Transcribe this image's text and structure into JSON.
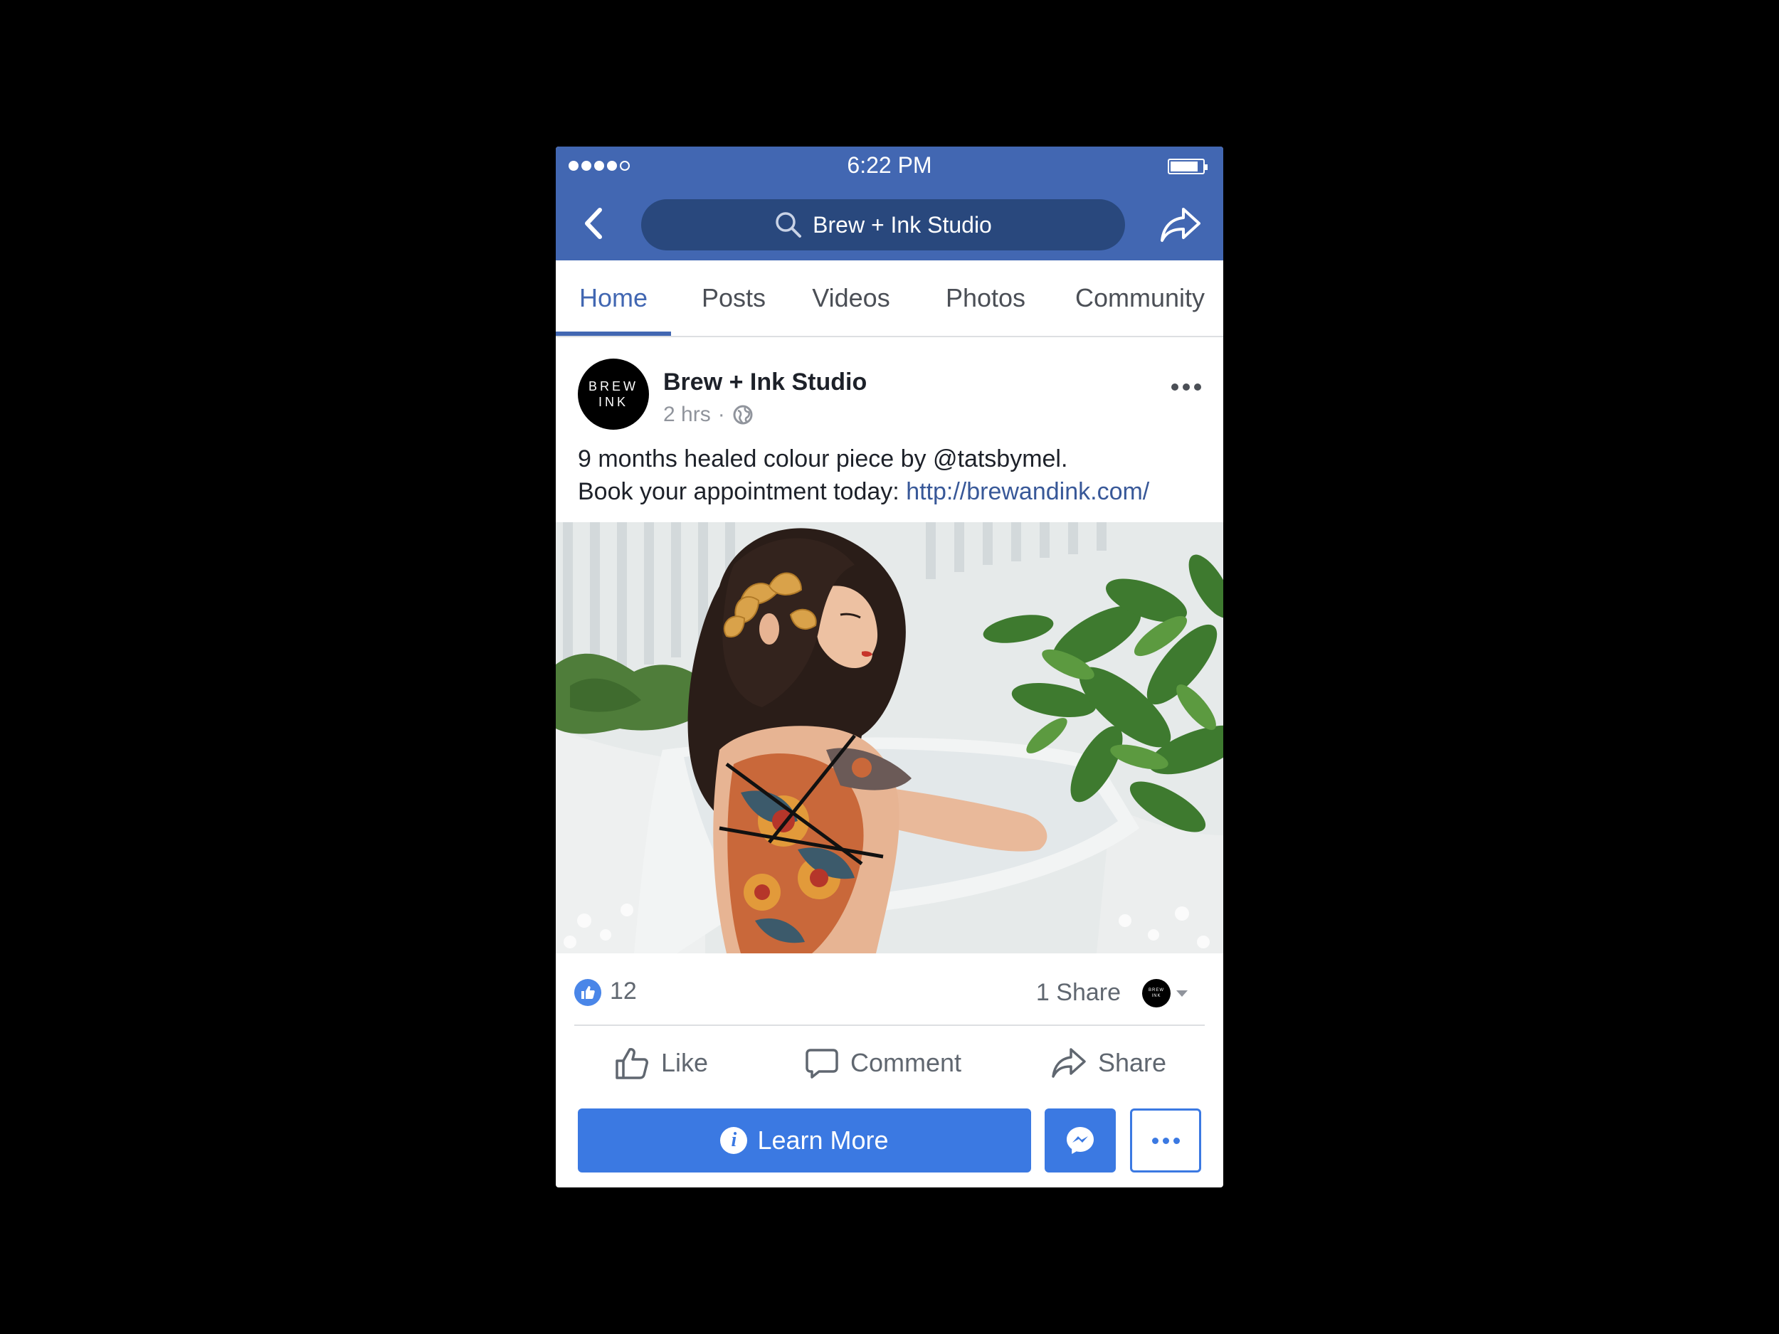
{
  "status_bar": {
    "time": "6:22 PM"
  },
  "nav": {
    "search_text": "Brew + Ink Studio"
  },
  "tabs": [
    {
      "label": "Home"
    },
    {
      "label": "Posts"
    },
    {
      "label": "Videos"
    },
    {
      "label": "Photos"
    },
    {
      "label": "Community"
    }
  ],
  "post": {
    "avatar_line1": "BREW",
    "avatar_line2": "INK",
    "author": "Brew + Ink Studio",
    "time_ago": "2 hrs",
    "separator": "·",
    "text_line1": "9 months healed colour piece by @tatsbymel.",
    "text_line2_prefix": "Book your appointment today: ",
    "link": "http://brewandink.com/",
    "like_count": "12",
    "share_count": "1 Share"
  },
  "actions": {
    "like": "Like",
    "comment": "Comment",
    "share": "Share"
  },
  "cta": {
    "learn_more": "Learn More"
  },
  "colors": {
    "facebook_blue": "#4267b2",
    "search_pill": "#29487d",
    "cta_blue": "#3b79e2",
    "link": "#385898"
  }
}
